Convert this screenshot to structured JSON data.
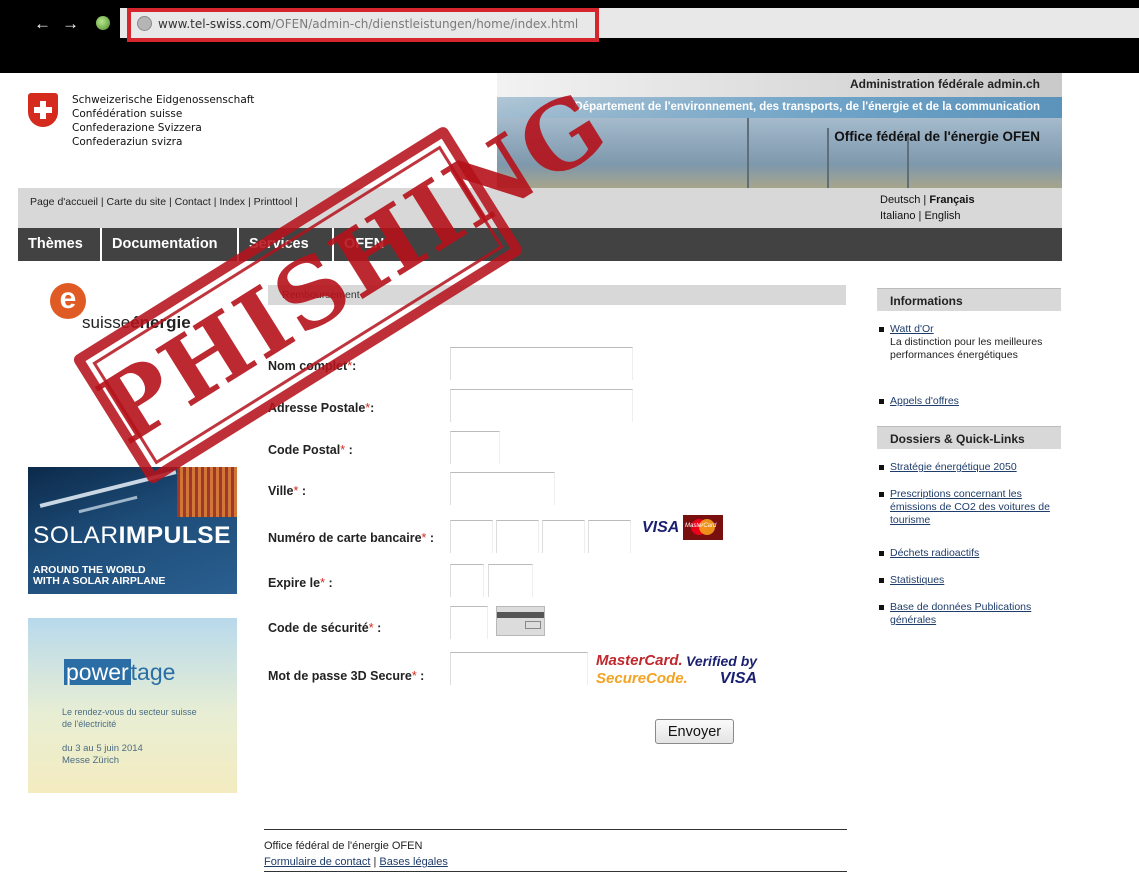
{
  "browser": {
    "url_host": "www.tel-swiss.com",
    "url_path": "/OFEN/admin-ch/dienstleistungen/home/index.html",
    "highlight_color": "#d4262c"
  },
  "header": {
    "confederation": [
      "Schweizerische Eidgenossenschaft",
      "Confédération suisse",
      "Confederazione Svizzera",
      "Confederaziun svizra"
    ],
    "admin": "Administration fédérale admin.ch",
    "department": "Département de l'environnement, des transports, de l'énergie et de la communication",
    "office": "Office fédéral de l'énergie OFEN"
  },
  "toplinks": {
    "home": "Page d'accueil",
    "sitemap": "Carte du site",
    "contact": "Contact",
    "index": "Index",
    "printtool": "Printtool"
  },
  "languages": {
    "de": "Deutsch",
    "fr": "Français",
    "it": "Italiano",
    "en": "English"
  },
  "mainnav": [
    "Thèmes",
    "Documentation",
    "Services",
    "OFEN"
  ],
  "left": {
    "se_logo_pre": "suisse",
    "se_logo_bold": "énergie",
    "solar_title_a": "SOLAR",
    "solar_title_b": "IMPULSE",
    "solar_sub1": "AROUND THE WORLD",
    "solar_sub2": "WITH A SOLAR AIRPLANE",
    "power_a": "power",
    "power_b": "tage",
    "power_desc1": "Le rendez-vous du secteur suisse",
    "power_desc2": "de l'électricité",
    "power_date": "du 3 au 5 juin 2014",
    "power_place": "Messe Zürich"
  },
  "form": {
    "section": "Remboursement",
    "labels": {
      "name": "Nom complet",
      "address": "Adresse Postale",
      "zip": "Code Postal",
      "city": "Ville",
      "card": "Numéro de carte bancaire",
      "expiry": "Expire le",
      "cvv": "Code de sécurité",
      "secure3d": "Mot de passe 3D Secure"
    },
    "required_mark": "*",
    "submit": "Envoyer",
    "visa": "VISA",
    "mastercard_small": "MasterCard",
    "mc_securecode_a": "MasterCard.",
    "mc_securecode_b": "SecureCode.",
    "vbv_a": "Verified by",
    "vbv_b": "VISA"
  },
  "sidebar": {
    "info_title": "Informations",
    "info_items": [
      {
        "link": "Watt d'Or",
        "desc": "La distinction pour les meilleures performances énergétiques"
      },
      {
        "link": "Appels d'offres",
        "desc": ""
      }
    ],
    "dossiers_title": "Dossiers & Quick-Links",
    "dossiers_items": [
      "Stratégie énergétique 2050",
      "Prescriptions concernant les émissions de CO2 des voitures de tourisme",
      "Déchets radioactifs",
      "Statistiques",
      "Base de données Publications générales"
    ]
  },
  "footer": {
    "office": "Office fédéral de l'énergie OFEN",
    "contact_form": "Formulaire de contact",
    "legal": "Bases légales"
  },
  "stamp": {
    "text": "PHISHING",
    "color": "#b5121b"
  }
}
